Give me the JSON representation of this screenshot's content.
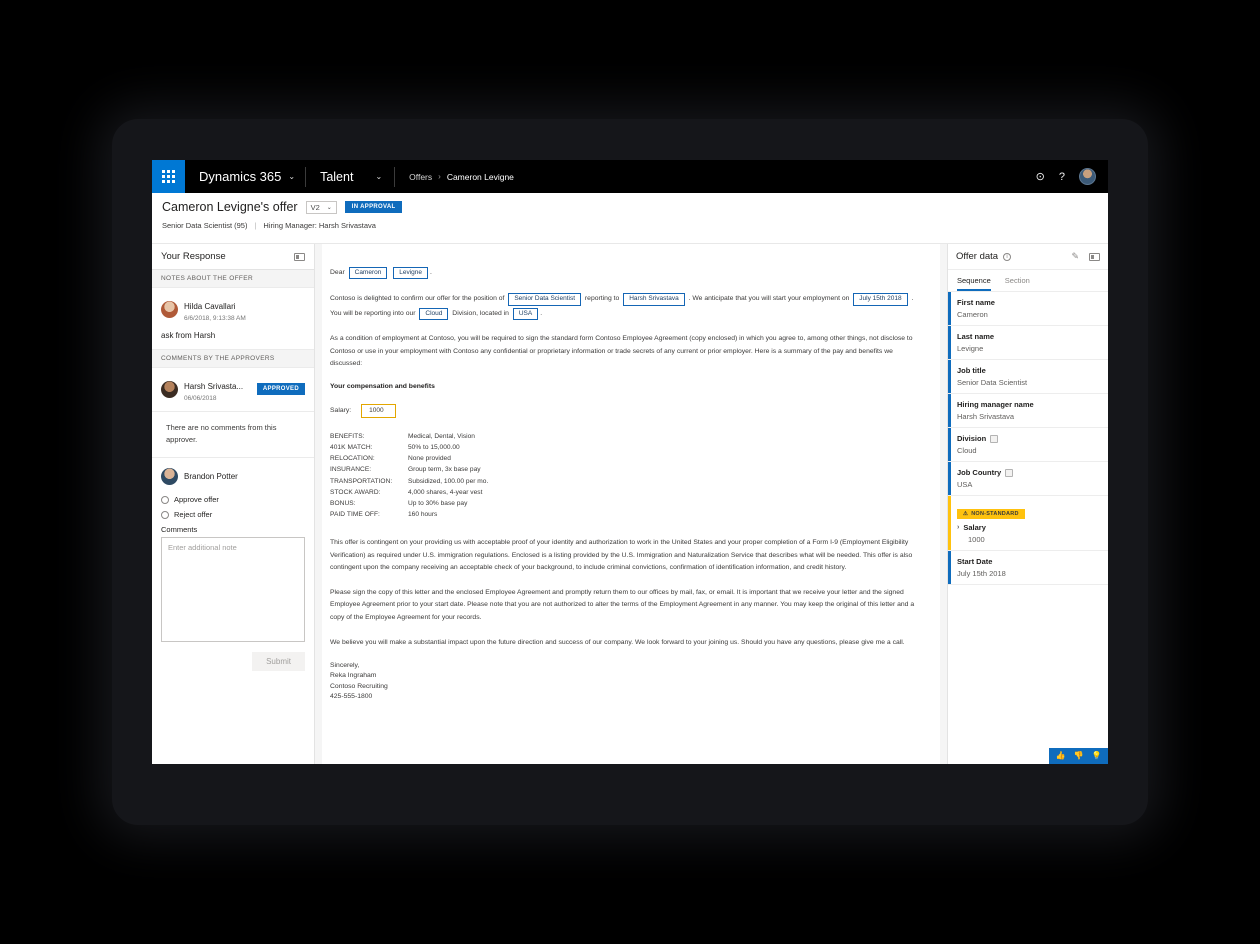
{
  "topnav": {
    "waffle_icon": "waffle-grid-icon",
    "brand": "Dynamics 365",
    "app": "Talent",
    "chevron": "⌄",
    "breadcrumb_parent": "Offers",
    "breadcrumb_sep": "›",
    "breadcrumb_current": "Cameron Levigne",
    "gear_icon": "⊙",
    "help_icon": "?",
    "avatar": "user-avatar"
  },
  "pagehead": {
    "title": "Cameron Levigne's offer",
    "version": "V2",
    "version_chevron": "⌄",
    "status": "IN APPROVAL",
    "subtitle_job": "Senior Data Scientist (95)",
    "divider": "|",
    "subtitle_manager": "Hiring Manager: Harsh Srivastava"
  },
  "sidebar": {
    "header": "Your Response",
    "panel_icon": "panel-collapse-icon",
    "section_notes": "NOTES ABOUT THE OFFER",
    "note": {
      "author": "Hilda Cavallari",
      "timestamp": "6/6/2018, 9:13:38 AM",
      "text": "ask from Harsh"
    },
    "section_comments": "COMMENTS BY THE APPROVERS",
    "approver": {
      "name": "Harsh Srivasta...",
      "date": "06/06/2018",
      "status": "APPROVED",
      "no_comment": "There are no comments from this approver."
    },
    "response": {
      "user": "Brandon Potter",
      "option_approve": "Approve offer",
      "option_reject": "Reject offer",
      "comments_label": "Comments",
      "comments_placeholder": "Enter additional note",
      "comments_value": "",
      "submit_label": "Submit"
    }
  },
  "document": {
    "salutation_pre": "Dear",
    "field_first": "Cameron",
    "field_last": "Levigne",
    "salutation_post": ".",
    "p1_a": "Contoso is delighted to confirm our offer for the position of",
    "field_jobtitle": "Senior Data Scientist",
    "p1_b": "reporting to",
    "field_manager": "Harsh Srivastava",
    "p1_c": ". We anticipate that you will start your employment on",
    "field_startdate": "July 15th 2018",
    "p1_d": ". You will be reporting into our",
    "field_division": "Cloud",
    "p1_e": "Division, located in",
    "field_country": "USA",
    "p1_f": ".",
    "p2": "As a condition of employment at Contoso, you will be required to sign the standard form Contoso Employee Agreement (copy enclosed) in which you agree to, among other things, not disclose to Contoso or use in your employment with Contoso any confidential or proprietary information or trade secrets of any current or prior employer. Here is a summary of the pay and benefits we discussed:",
    "heading_comp": "Your compensation and benefits",
    "salary_label": "Salary:",
    "salary_value": "1000",
    "benefits": [
      {
        "key": "BENEFITS:",
        "value": "Medical, Dental, Vision"
      },
      {
        "key": "401K MATCH:",
        "value": "50% to 15,000.00"
      },
      {
        "key": "RELOCATION:",
        "value": "None provided"
      },
      {
        "key": "INSURANCE:",
        "value": "Group term, 3x base pay"
      },
      {
        "key": "TRANSPORTATION:",
        "value": "Subsidized, 100.00 per mo."
      },
      {
        "key": "STOCK AWARD:",
        "value": "4,000 shares, 4-year vest"
      },
      {
        "key": "BONUS:",
        "value": "Up to 30% base pay"
      },
      {
        "key": "PAID TIME OFF:",
        "value": "160 hours"
      }
    ],
    "p3": "This offer is contingent on your providing us with acceptable proof of your identity and authorization to work in the United States and your proper completion of a Form I-9 (Employment Eligibility Verification) as required under U.S. immigration regulations. Enclosed is a listing provided by the U.S. Immigration and Naturalization Service that describes what will be needed. This offer is also contingent upon the company receiving an acceptable check of your background, to include criminal convictions, confirmation of identification information, and credit history.",
    "p4": "Please sign the copy of this letter and the enclosed Employee Agreement and promptly return them to our offices by mail, fax, or email. It is important that we receive your letter and the signed Employee Agreement prior to your start date. Please note that you are not authorized to alter the terms of the Employment Agreement in any manner. You may keep the original of this letter and a copy of the Employee Agreement for your records.",
    "p5": "We believe you will make a substantial impact upon the future direction and success of our company. We look forward to your joining us. Should you have any questions, please give me a call.",
    "sign_1": "Sincerely,",
    "sign_2": "Reka Ingraham",
    "sign_3": "Contoso Recruiting",
    "sign_4": "425-555-1800"
  },
  "offerdata": {
    "title": "Offer data",
    "info_icon": "ⓘ",
    "pencil_icon": "✐",
    "panel_icon": "panel-collapse-icon",
    "tabs": [
      {
        "label": "Sequence",
        "active": true
      },
      {
        "label": "Section",
        "active": false
      }
    ],
    "fields": [
      {
        "label": "First name",
        "value": "Cameron",
        "link": false,
        "warn": false
      },
      {
        "label": "Last name",
        "value": "Levigne",
        "link": false,
        "warn": false
      },
      {
        "label": "Job title",
        "value": "Senior Data Scientist",
        "link": false,
        "warn": false
      },
      {
        "label": "Hiring manager name",
        "value": "Harsh Srivastava",
        "link": false,
        "warn": false
      },
      {
        "label": "Division",
        "value": "Cloud",
        "link": true,
        "warn": false
      },
      {
        "label": "Job Country",
        "value": "USA",
        "link": true,
        "warn": false
      },
      {
        "label": "Salary",
        "value": "1000",
        "link": false,
        "warn": true,
        "badge": "NON-STANDARD"
      },
      {
        "label": "Start Date",
        "value": "July 15th 2018",
        "link": false,
        "warn": false
      }
    ],
    "badge_warn_icon": "⚠",
    "expand_chevron": "›"
  },
  "feedback": {
    "like_icon": "ὄD",
    "dislike_icon": "ὄE",
    "idea_icon": "Ὂ1"
  },
  "colors": {
    "accent": "#0f6cbd",
    "warn": "#ffc20e",
    "field_border": "#1566b5",
    "field_warn_border": "#e3a600"
  }
}
